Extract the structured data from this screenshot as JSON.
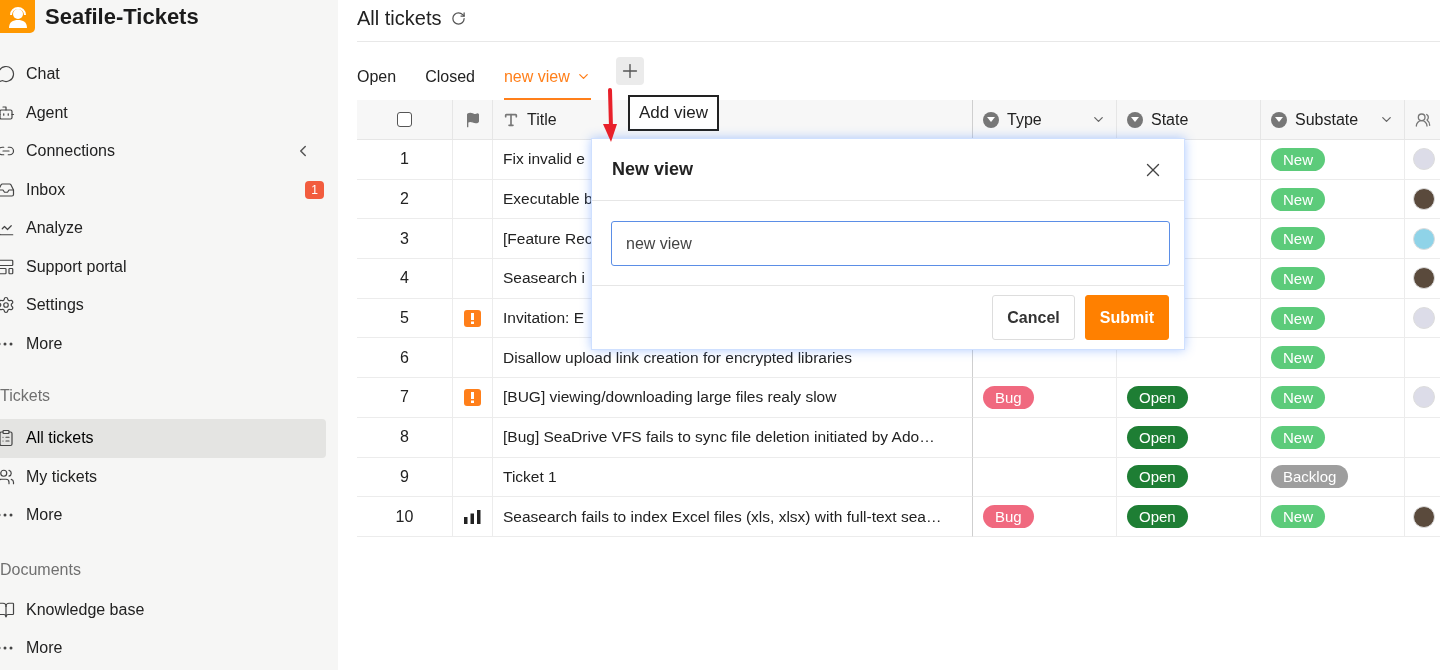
{
  "app": {
    "title": "Seafile-Tickets"
  },
  "sidebar": {
    "items": [
      {
        "label": "Chat",
        "selected": false
      },
      {
        "label": "Agent",
        "selected": false
      },
      {
        "label": "Connections",
        "selected": false,
        "expanded": false
      },
      {
        "label": "Inbox",
        "selected": false,
        "badge": "1"
      },
      {
        "label": "Analyze",
        "selected": false
      },
      {
        "label": "Support portal",
        "selected": false
      },
      {
        "label": "Settings",
        "selected": false
      },
      {
        "label": "More",
        "selected": false
      }
    ],
    "sections": [
      {
        "title": "Tickets",
        "items": [
          {
            "label": "All tickets",
            "selected": true
          },
          {
            "label": "My tickets",
            "selected": false
          },
          {
            "label": "More",
            "selected": false
          }
        ]
      },
      {
        "title": "Documents",
        "items": [
          {
            "label": "Knowledge base",
            "selected": false
          },
          {
            "label": "More",
            "selected": false
          }
        ]
      }
    ]
  },
  "page": {
    "title": "All tickets"
  },
  "tabs": [
    {
      "label": "Open",
      "selected": false
    },
    {
      "label": "Closed",
      "selected": false
    },
    {
      "label": "new view",
      "selected": true
    }
  ],
  "tooltip": "Add view",
  "table": {
    "header_checked": false,
    "columns": [
      {
        "label": "Title"
      },
      {
        "label": "Type"
      },
      {
        "label": "State"
      },
      {
        "label": "Substate"
      }
    ],
    "rows": [
      {
        "number": "1",
        "kind": "plain",
        "title": "Fix invalid e",
        "substate": {
          "label": "New",
          "color": "#5ccb7a"
        },
        "avatar": {
          "color": "#dcdce8"
        }
      },
      {
        "number": "2",
        "kind": "plain",
        "title": "Executable b",
        "substate": {
          "label": "New",
          "color": "#5ccb7a"
        },
        "avatar": {
          "color": "#5a4a3c"
        }
      },
      {
        "number": "3",
        "kind": "plain",
        "title": "[Feature Rec",
        "substate": {
          "label": "New",
          "color": "#5ccb7a"
        },
        "avatar": {
          "color": "#8fd3e8"
        }
      },
      {
        "number": "4",
        "kind": "plain",
        "title": "Seasearch i",
        "substate": {
          "label": "New",
          "color": "#5ccb7a"
        },
        "avatar": {
          "color": "#5a4a3c"
        }
      },
      {
        "number": "5",
        "kind": "urgent",
        "title": "Invitation: E",
        "substate": {
          "label": "New",
          "color": "#5ccb7a"
        },
        "avatar": {
          "color": "#dcdce8"
        }
      },
      {
        "number": "6",
        "kind": "plain",
        "title": "Disallow upload link creation for encrypted libraries",
        "substate": {
          "label": "New",
          "color": "#5ccb7a"
        }
      },
      {
        "number": "7",
        "kind": "urgent",
        "title": "[BUG] viewing/downloading large files realy slow",
        "type": {
          "label": "Bug",
          "color": "#f0697f"
        },
        "state": {
          "label": "Open",
          "color": "#1e7e34"
        },
        "substate": {
          "label": "New",
          "color": "#5ccb7a"
        },
        "avatar": {
          "color": "#dcdce8"
        }
      },
      {
        "number": "8",
        "kind": "plain",
        "title": "[Bug] SeaDrive VFS fails to sync file deletion initiated by Ado…",
        "state": {
          "label": "Open",
          "color": "#1e7e34"
        },
        "substate": {
          "label": "New",
          "color": "#5ccb7a"
        }
      },
      {
        "number": "9",
        "kind": "plain",
        "title": "Ticket 1",
        "state": {
          "label": "Open",
          "color": "#1e7e34"
        },
        "substate": {
          "label": "Backlog",
          "color": "#9e9e9e"
        }
      },
      {
        "number": "10",
        "kind": "priority",
        "title": "Seasearch fails to index Excel files (xls, xlsx) with full-text sea…",
        "type": {
          "label": "Bug",
          "color": "#f0697f"
        },
        "state": {
          "label": "Open",
          "color": "#1e7e34"
        },
        "substate": {
          "label": "New",
          "color": "#5ccb7a"
        },
        "avatar": {
          "color": "#5a4a3c"
        }
      }
    ]
  },
  "dialog": {
    "title": "New view",
    "value": "new view",
    "buttons": [
      {
        "label": "Cancel",
        "kind": "secondary"
      },
      {
        "label": "Submit",
        "kind": "primary"
      }
    ]
  }
}
